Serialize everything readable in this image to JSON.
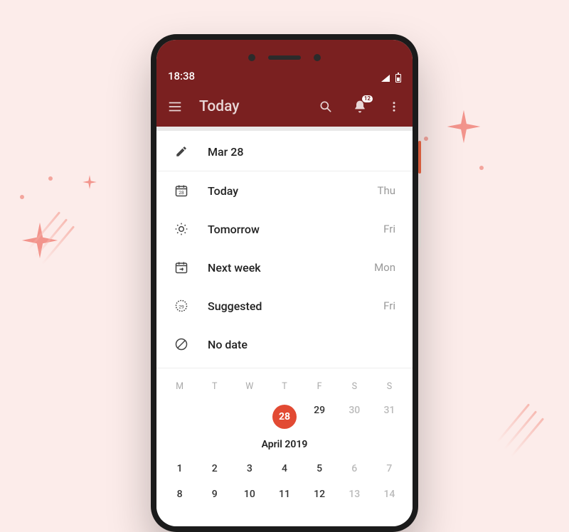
{
  "status": {
    "time": "18:38"
  },
  "appbar": {
    "title": "Today",
    "notification_badge": "12"
  },
  "editor": {
    "date_label": "Mar 28"
  },
  "quickdates": [
    {
      "label": "Today",
      "daylabel": "Thu",
      "icon": "calendar-today"
    },
    {
      "label": "Tomorrow",
      "daylabel": "Fri",
      "icon": "sun"
    },
    {
      "label": "Next week",
      "daylabel": "Mon",
      "icon": "calendar-next"
    },
    {
      "label": "Suggested",
      "daylabel": "Fri",
      "icon": "calendar-suggest"
    },
    {
      "label": "No date",
      "daylabel": "",
      "icon": "nodate"
    }
  ],
  "calendar": {
    "weekday_headers": [
      "M",
      "T",
      "W",
      "T",
      "F",
      "S",
      "S"
    ],
    "month_label": "April 2019",
    "rows": [
      [
        {
          "d": "",
          "dim": true
        },
        {
          "d": "",
          "dim": true
        },
        {
          "d": "",
          "dim": true
        },
        {
          "d": "28",
          "today": true
        },
        {
          "d": "29"
        },
        {
          "d": "30",
          "dim": true
        },
        {
          "d": "31",
          "dim": true
        }
      ],
      [
        {
          "d": "1"
        },
        {
          "d": "2"
        },
        {
          "d": "3"
        },
        {
          "d": "4"
        },
        {
          "d": "5"
        },
        {
          "d": "6",
          "dim": true
        },
        {
          "d": "7",
          "dim": true
        }
      ],
      [
        {
          "d": "8"
        },
        {
          "d": "9"
        },
        {
          "d": "10"
        },
        {
          "d": "11"
        },
        {
          "d": "12"
        },
        {
          "d": "13",
          "dim": true
        },
        {
          "d": "14",
          "dim": true
        }
      ]
    ]
  },
  "colors": {
    "accent": "#e24a33",
    "appbar": "#7a2020"
  }
}
